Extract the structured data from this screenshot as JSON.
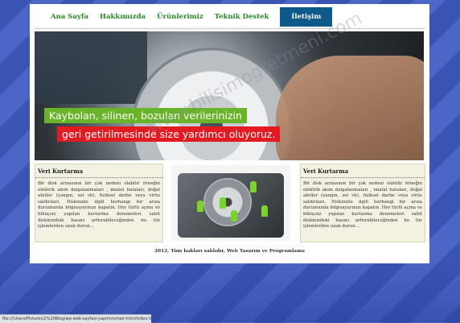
{
  "nav": {
    "items": [
      "Ana Sayfa",
      "Hakkımızda",
      "Ürünlerimiz",
      "Teknik Destek",
      "İletişim"
    ],
    "active": "İletişim"
  },
  "banner": {
    "caption_line1": "Kaybolan, silinen, bozulan verilerinizin",
    "caption_line2": "geri getirilmesinde size yardımcı oluyoruz."
  },
  "columns": {
    "left": {
      "title": "Veri Kurtarma",
      "text": "Bir disk arızasının bir çok nedeni olabilir örneğin elektrik akım dalgalanmaları , imalat hataları, doğal afetler (yangın, sel vb), fiziksel darbe veya virüs saldırıları. Diskinizle ilgili herhangi bir arıza durumunda bilgisayarınızı kapatın. Her türlü açma ve bilinçsiz yapılan kurtarma denemeleri sabit diskinizdeki hasarı arttırabileceğinden bu tür işlemlerden uzak durun..."
    },
    "right": {
      "title": "Veri Kurtarma",
      "text": "Bir disk arızasının bir çok nedeni olabilir örneğin elektrik akım dalgalanmaları , imalat hataları, doğal afetler (yangın, sel vb), fiziksel darbe veya virüs saldırıları. Diskinizle ilgili herhangi bir arıza durumunda bilgisayarınızı kapatın. Her türlü açma ve bilinçsiz yapılan kurtarma denemeleri sabit diskinizdeki hasarı arttırabileceğinden bu tür işlemlerden uzak durun..."
    }
  },
  "footer": {
    "text": "2012, Tüm hakları saklıdır, Web Tasarım ve Programlama"
  },
  "watermark": {
    "text": "www.bilisimogretmeni.com"
  },
  "statusbar": {
    "text": "file:///Users/Pictures/2%20Blog/wp-web-sayfasi-yapimi/ornek-html/index.html"
  },
  "colors": {
    "nav_active_bg": "#0d5a8a",
    "nav_link": "#2a8a2a",
    "caption1_bg": "#6ab42a",
    "caption2_bg": "#e21a22"
  }
}
